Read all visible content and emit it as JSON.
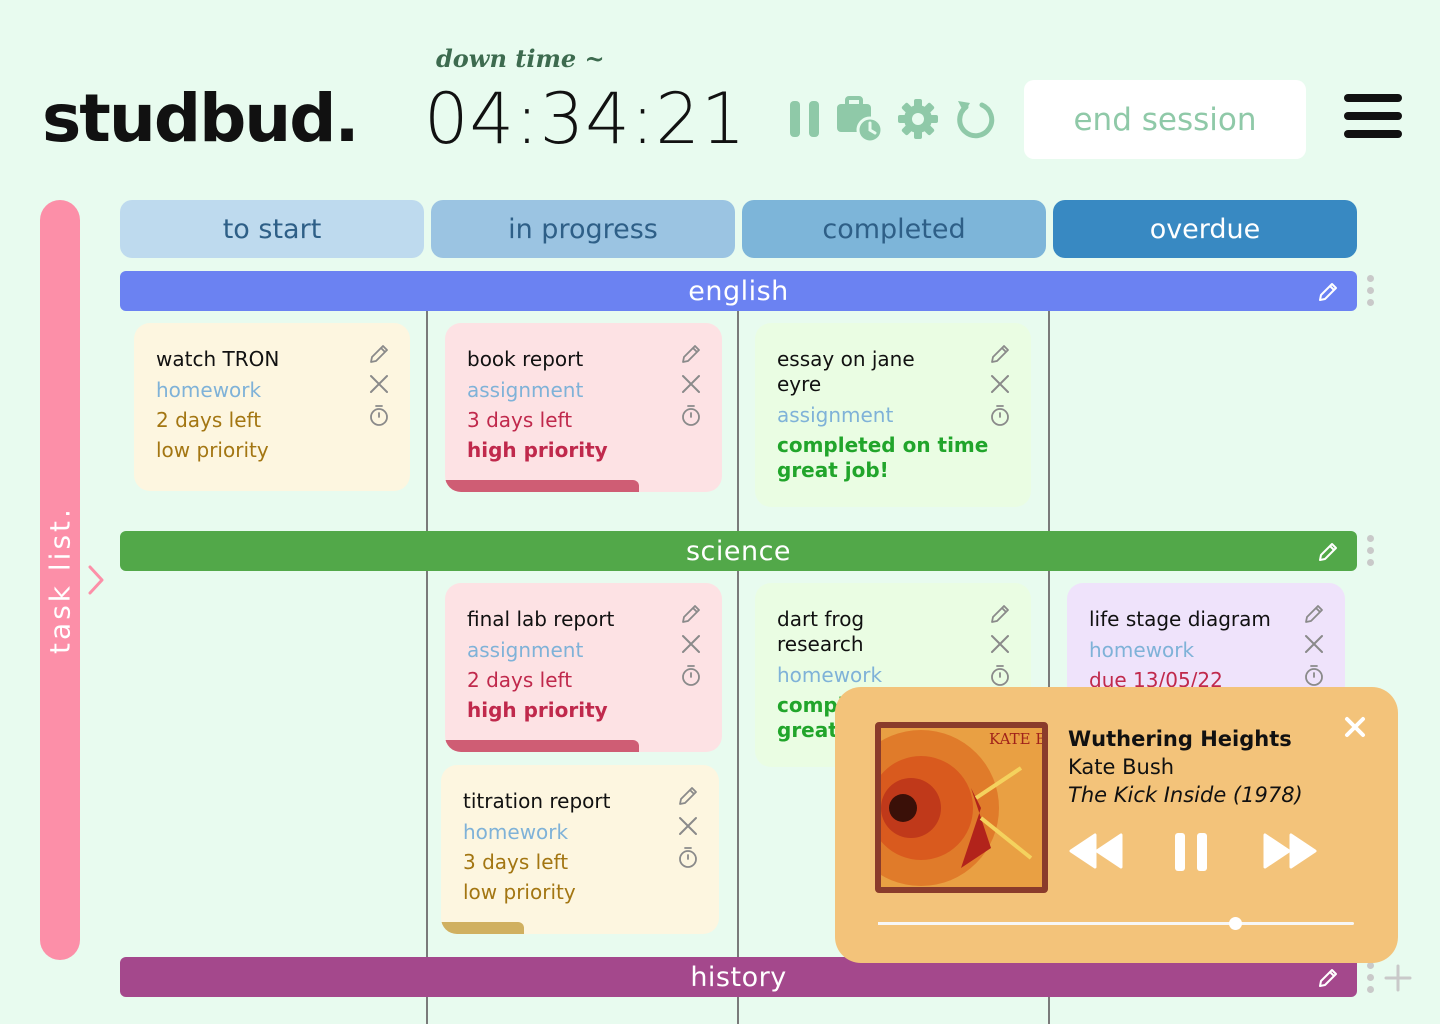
{
  "header": {
    "logo": "studbud.",
    "subtitle": "down time ~",
    "timer": "04:34:21",
    "end_label": "end session"
  },
  "controls": [
    "pause-icon",
    "briefcase-clock-icon",
    "gear-icon",
    "reset-icon"
  ],
  "sidebar": {
    "label": "task list."
  },
  "columns": [
    "to start",
    "in progress",
    "completed",
    "overdue"
  ],
  "subjects": [
    {
      "name": "english",
      "color": "#6b82f2"
    },
    {
      "name": "science",
      "color": "#52a849"
    },
    {
      "name": "history",
      "color": "#a4488c"
    }
  ],
  "cards": {
    "watch_tron": {
      "title": "watch TRON",
      "type": "homework",
      "status": "2 days left",
      "priority": "low priority"
    },
    "book_report": {
      "title": "book report",
      "type": "assignment",
      "status": "3 days left",
      "priority": "high priority",
      "progress": 0.7
    },
    "essay_jane_eyre": {
      "title": "essay on jane eyre",
      "type": "assignment",
      "status": "completed on time",
      "priority": "great job!"
    },
    "final_lab_report": {
      "title": "final lab report",
      "type": "assignment",
      "status": "2 days left",
      "priority": "high priority",
      "progress": 0.7
    },
    "titration_report": {
      "title": "titration report",
      "type": "homework",
      "status": "3 days left",
      "priority": "low priority",
      "progress": 0.3
    },
    "dart_frog": {
      "title": "dart frog research",
      "type": "homework",
      "status": "completed on time",
      "priority": "great job!"
    },
    "life_stage": {
      "title": "life stage diagram",
      "type": "homework",
      "status": "due 13/05/22"
    }
  },
  "player": {
    "song": "Wuthering Heights",
    "artist": "Kate Bush",
    "album": "The Kick Inside (1978)",
    "album_art_text": "KATE BUSH",
    "progress": 0.75
  },
  "colors": {
    "background": "#e8fbef",
    "sidebar": "#fc8fa8",
    "accent": "#8fc9a8",
    "high_priority": "#c0294c",
    "low_priority": "#a37612",
    "completed": "#21a52b",
    "type_text": "#7fb2d8"
  }
}
